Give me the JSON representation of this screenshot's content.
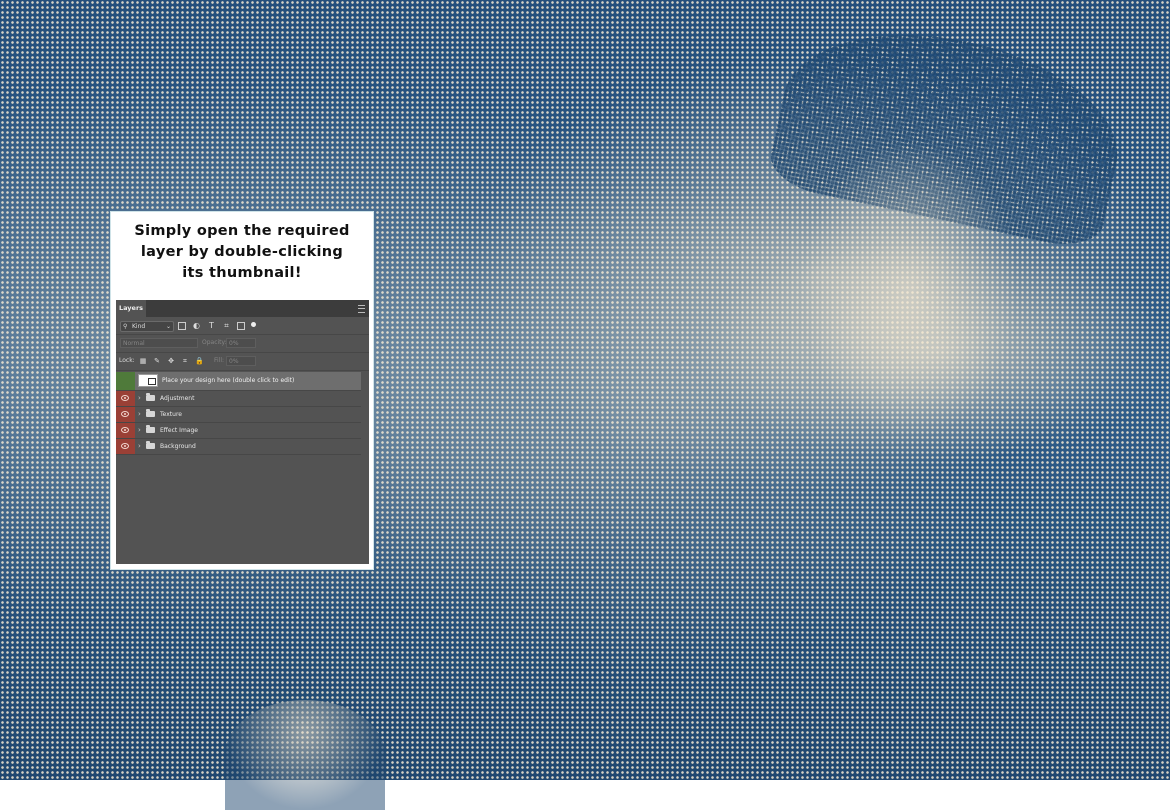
{
  "headline": {
    "line1": "Simply open the required",
    "line2": "layer by double-clicking",
    "line3": "its thumbnail!"
  },
  "panel": {
    "tab_label": "Layers",
    "menu_icon": "panel-menu-icon",
    "filter": {
      "kind_label": "Kind",
      "icons": [
        "image-filter-icon",
        "adjustment-filter-icon",
        "type-filter-icon",
        "shape-filter-icon",
        "smart-object-filter-icon",
        "filter-toggle-dot-icon"
      ]
    },
    "blend_mode": "Normal",
    "opacity_label": "Opacity:",
    "opacity_value": "0%",
    "lock_label": "Lock:",
    "lock_icons": [
      "lock-transparent-icon",
      "lock-brush-icon",
      "lock-move-icon",
      "lock-artboard-icon",
      "lock-all-icon"
    ],
    "fill_label": "Fill:",
    "fill_value": "0%",
    "layers": [
      {
        "name": "Place your design here (double click to edit)",
        "type": "smart-object",
        "selected": true
      },
      {
        "name": "Adjustment",
        "type": "group"
      },
      {
        "name": "Texture",
        "type": "group"
      },
      {
        "name": "Effect Image",
        "type": "group"
      },
      {
        "name": "Background",
        "type": "group"
      }
    ]
  },
  "colors": {
    "halftone_blue": "#2d5a86",
    "halftone_cream": "#f5e9d2",
    "panel_bg": "#535353",
    "eye_red": "#9a4036",
    "eye_green": "#4f7a3a"
  }
}
